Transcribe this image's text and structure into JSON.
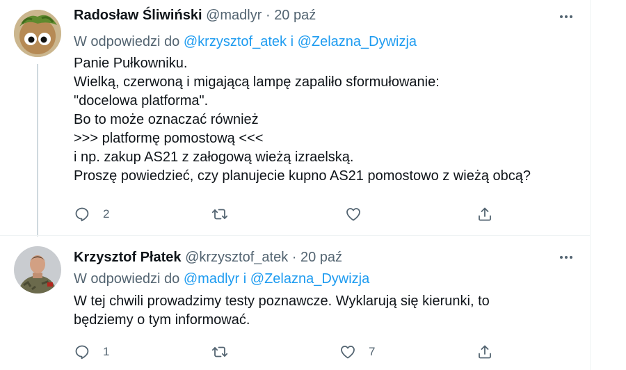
{
  "tweets": [
    {
      "name": "Radosław Śliwiński",
      "handle": "@madlyr",
      "separator": "·",
      "date": "20 paź",
      "reply_prefix": "W odpowiedzi do",
      "reply_mention_1": "@krzysztof_atek",
      "reply_conj": "i",
      "reply_mention_2": "@Zelazna_Dywizja",
      "text": "Panie Pułkowniku.\nWielką, czerwoną i migającą lampę zapaliło sformułowanie:\n\"docelowa platforma\".\nBo to może oznaczać również\n>>> platformę pomostową <<<\ni np. zakup AS21 z załogową wieżą izraelską.\nProszę powiedzieć, czy planujecie kupno AS21 pomostowo z wieżą obcą?",
      "reply_count": "2",
      "retweet_count": "",
      "like_count": "",
      "avatar_icon": "avatar-plant-face"
    },
    {
      "name": "Krzysztof Płatek",
      "handle": "@krzysztof_atek",
      "separator": "·",
      "date": "20 paź",
      "reply_prefix": "W odpowiedzi do",
      "reply_mention_1": "@madlyr",
      "reply_conj": "i",
      "reply_mention_2": "@Zelazna_Dywizja",
      "text": "W tej chwili prowadzimy testy poznawcze. Wyklarują się kierunki, to\nbędziemy o tym informować.",
      "reply_count": "1",
      "retweet_count": "",
      "like_count": "7",
      "avatar_icon": "avatar-soldier"
    }
  ],
  "icons": {
    "more": "more-icon",
    "reply": "reply-icon",
    "retweet": "retweet-icon",
    "like": "like-icon",
    "share": "share-icon"
  },
  "colors": {
    "text": "#0f1419",
    "secondary": "#536471",
    "link": "#1d9bf0",
    "thread_line": "#cfd9de"
  }
}
